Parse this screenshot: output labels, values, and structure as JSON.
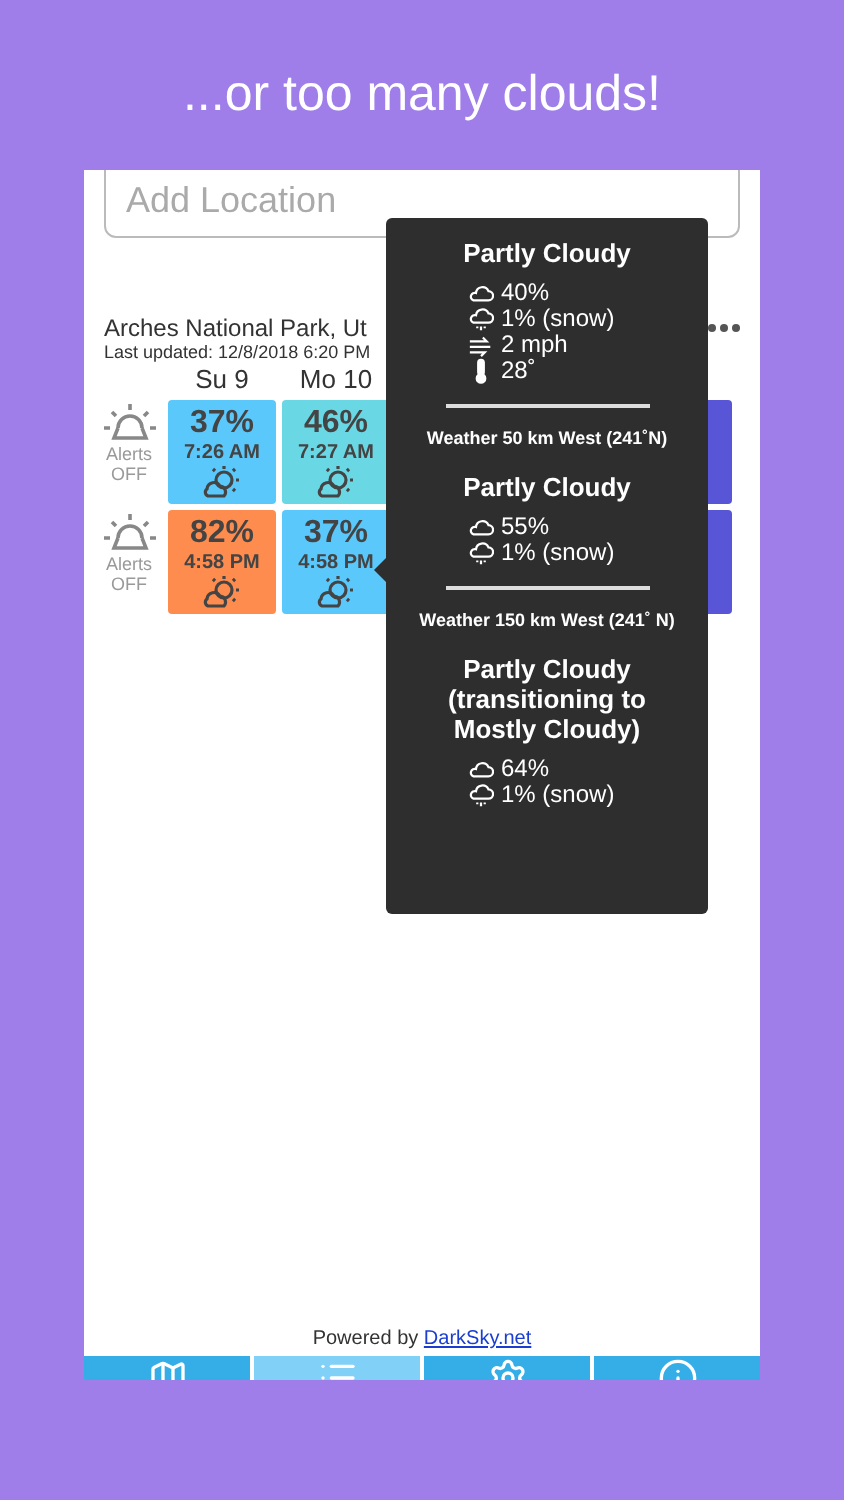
{
  "headline": "...or too many clouds!",
  "search": {
    "placeholder": "Add Location"
  },
  "location": {
    "name": "Arches National Park, Ut",
    "updated": "Last updated: 12/8/2018 6:20 PM"
  },
  "days": [
    "Su 9",
    "Mo 10"
  ],
  "rows": [
    {
      "alerts_label": "Alerts",
      "alerts_state": "OFF",
      "tiles": [
        {
          "percent": "37%",
          "time": "7:26 AM",
          "color": "#5ac8fa"
        },
        {
          "percent": "46%",
          "time": "7:27 AM",
          "color": "#6ad8e4"
        },
        {
          "kind": "hidden"
        },
        {
          "kind": "hidden"
        },
        {
          "color": "#5856d6"
        }
      ]
    },
    {
      "alerts_label": "Alerts",
      "alerts_state": "OFF",
      "tiles": [
        {
          "percent": "82%",
          "time": "4:58 PM",
          "color": "#fd8c4e"
        },
        {
          "percent": "37%",
          "time": "4:58 PM",
          "color": "#5ac8fa"
        },
        {
          "kind": "hidden"
        },
        {
          "kind": "hidden"
        },
        {
          "color": "#5856d6"
        }
      ]
    }
  ],
  "popover": {
    "sections": [
      {
        "title": "Partly Cloudy",
        "details": [
          {
            "kind": "cloud",
            "text": "40%"
          },
          {
            "kind": "precip",
            "text": "1% (snow)"
          },
          {
            "kind": "wind",
            "text": "2 mph"
          },
          {
            "kind": "temp",
            "text": "28˚"
          }
        ]
      },
      {
        "heading": "Weather 50 km West (241˚N)",
        "title": "Partly Cloudy",
        "details": [
          {
            "kind": "cloud",
            "text": "55%"
          },
          {
            "kind": "precip",
            "text": "1% (snow)"
          }
        ]
      },
      {
        "heading": "Weather 150 km West (241˚ N)",
        "title": "Partly Cloudy (transitioning to Mostly Cloudy)",
        "details": [
          {
            "kind": "cloud",
            "text": "64%"
          },
          {
            "kind": "precip",
            "text": "1% (snow)"
          }
        ]
      }
    ]
  },
  "footer": {
    "text": "Powered by",
    "link": "DarkSky.net"
  },
  "tabs": [
    {
      "kind": "map",
      "selected": false
    },
    {
      "kind": "list",
      "selected": true
    },
    {
      "kind": "settings",
      "selected": false
    },
    {
      "kind": "info",
      "selected": false
    }
  ]
}
